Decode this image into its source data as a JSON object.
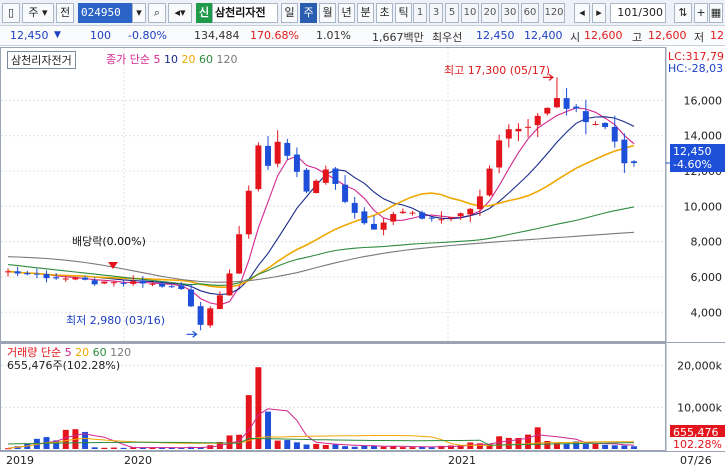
{
  "toolbar": {
    "market": "주",
    "prefix": "전",
    "code": "024950",
    "grp": "신",
    "name": "삼천리자전",
    "periods": [
      "일",
      "주",
      "월",
      "년",
      "분",
      "초",
      "틱"
    ],
    "active_period": "주",
    "digits": [
      "1",
      "3",
      "5",
      "10",
      "20",
      "30",
      "60",
      "120"
    ],
    "count": "101",
    "count_total": "/300"
  },
  "quote": {
    "price": "12,450",
    "change": "100",
    "change_pct": "-0.80%",
    "volume": "134,484",
    "vol_ratio": "170.68%",
    "turnover": "1.01%",
    "amount": "1,667백만",
    "ask_label": "최우선",
    "ask": "12,450",
    "bid": "12,400",
    "open_label": "시",
    "open": "12,600",
    "high_label": "고",
    "high": "12,600",
    "low_label": "저",
    "low": "12"
  },
  "price_panel": {
    "name_box": "삼천리자전거",
    "legend_prefix": "종가 단순",
    "ma_labels": [
      "5",
      "10",
      "20",
      "60",
      "120"
    ],
    "lc": "LC:317,79",
    "hc": "HC:-28,03",
    "current_price": "12,450",
    "current_pct": "-4.60%",
    "high_note": "최고 17,300 (05/17)",
    "low_note": "최저 2,980 (03/16)",
    "dividend_note": "배당락(0.00%)",
    "yticks": [
      "16,000",
      "14,000",
      "12,000",
      "10,000",
      "8,000",
      "6,000",
      "4,000"
    ]
  },
  "volume_panel": {
    "legend_prefix": "거래량 단순",
    "ma_labels": [
      "5",
      "20",
      "60",
      "120"
    ],
    "last_volume_text": "655,476주(102.28%)",
    "badge_volume": "655,476",
    "badge_pct": "102.28%",
    "yticks": [
      "20,000k",
      "10,000k"
    ]
  },
  "xaxis": {
    "labels": [
      "2019",
      "2020",
      "2021",
      "07/26"
    ]
  },
  "colors": {
    "up": "#e3141b",
    "down": "#1d4fd8",
    "ma5": "#d1268f",
    "ma10": "#1a2a8a",
    "ma20": "#f0a800",
    "ma60": "#2e8b3e",
    "ma120": "#7a7a7a"
  },
  "chart_data": {
    "type": "candlestick",
    "ylim": [
      2600,
      18000
    ],
    "anchors": [
      [
        0,
        6300
      ],
      [
        6,
        5900
      ],
      [
        10,
        5600
      ],
      [
        14,
        5650
      ],
      [
        16,
        5500
      ],
      [
        18,
        5300
      ],
      [
        19,
        4300
      ],
      [
        20,
        3300
      ],
      [
        21,
        4300
      ],
      [
        22,
        5000
      ],
      [
        23,
        6200
      ],
      [
        26,
        13500
      ],
      [
        27,
        12000
      ],
      [
        28,
        13500
      ],
      [
        29,
        13000
      ],
      [
        31,
        11000
      ],
      [
        33,
        11800
      ],
      [
        36,
        9500
      ],
      [
        38,
        8500
      ],
      [
        40,
        9700
      ],
      [
        44,
        9300
      ],
      [
        47,
        9700
      ],
      [
        49,
        10400
      ],
      [
        51,
        13800
      ],
      [
        54,
        14700
      ],
      [
        57,
        16400
      ],
      [
        59,
        15300
      ],
      [
        62,
        14800
      ],
      [
        63,
        13600
      ],
      [
        64,
        12600
      ],
      [
        65,
        12450
      ]
    ],
    "high_point": {
      "index": 57,
      "value": 17300
    },
    "low_point": {
      "index": 20,
      "value": 2980
    },
    "volume_anchors": [
      [
        0,
        250
      ],
      [
        8,
        4300
      ],
      [
        9,
        300
      ],
      [
        18,
        350
      ],
      [
        20,
        700
      ],
      [
        24,
        2900
      ],
      [
        25,
        15600
      ],
      [
        26,
        21000
      ],
      [
        27,
        11800
      ],
      [
        28,
        1900
      ],
      [
        30,
        1200
      ],
      [
        35,
        700
      ],
      [
        45,
        600
      ],
      [
        50,
        1600
      ],
      [
        51,
        3600
      ],
      [
        53,
        3600
      ],
      [
        54,
        5200
      ],
      [
        57,
        2100
      ],
      [
        60,
        1500
      ],
      [
        65,
        655
      ]
    ],
    "volume_ylim": [
      0,
      24000
    ]
  }
}
